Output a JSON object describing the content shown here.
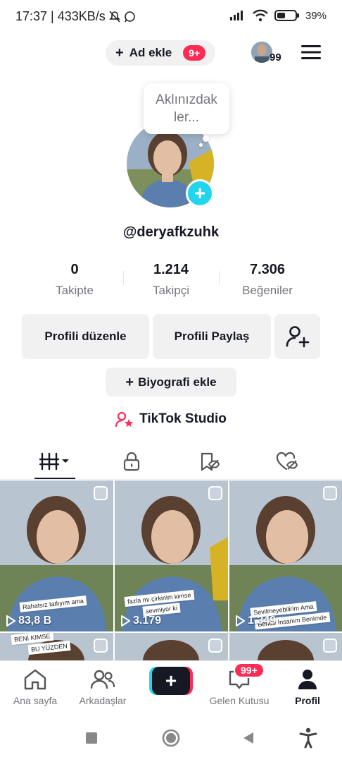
{
  "status_bar": {
    "time_info": "17:37 | 433KB/s",
    "battery": "39%",
    "icons": [
      "mute-bell-icon",
      "whatsapp-icon",
      "signal-icon",
      "wifi-icon",
      "battery-icon"
    ]
  },
  "top_bar": {
    "add_account_label": "Ad ekle",
    "notification_badge": "9+",
    "avatar_count": "99",
    "menu_icon": "hamburger-menu-icon"
  },
  "profile": {
    "bubble_text": "Aklınızdak ler...",
    "username": "@deryafkzuhk",
    "stats": [
      {
        "value": "0",
        "label": "Takipte"
      },
      {
        "value": "1.214",
        "label": "Takipçi"
      },
      {
        "value": "7.306",
        "label": "Beğeniler"
      }
    ],
    "edit_profile_label": "Profili düzenle",
    "share_profile_label": "Profili Paylaş",
    "add_bio_label": "Biyografi ekle",
    "studio_label": "TikTok Studio"
  },
  "tabs": [
    {
      "icon": "grid-videos-icon",
      "active": true
    },
    {
      "icon": "lock-icon",
      "active": false
    },
    {
      "icon": "saved-icon",
      "active": false
    },
    {
      "icon": "liked-icon",
      "active": false
    }
  ],
  "videos": [
    {
      "views": "83,8 B",
      "caption_1": "Rahatsız tatlıyım ama",
      "caption_2": "BENİ KIMSE",
      "caption_3": "BU YÜZDEN"
    },
    {
      "views": "3.179",
      "caption_1": "fazla mı çirkinim kimse",
      "caption_2": "sevmiyor ki"
    },
    {
      "views": "1.349",
      "caption_1": "Sevilmeyebilirim Ama",
      "caption_2": "Bende İnsanım Benimde"
    }
  ],
  "bottom_nav": {
    "home_label": "Ana sayfa",
    "friends_label": "Arkadaşlar",
    "inbox_label": "Gelen Kutusu",
    "inbox_badge": "99+",
    "profile_label": "Profil"
  },
  "colors": {
    "accent_red": "#fe2c55",
    "accent_cyan": "#20d5ec",
    "text_primary": "#161823",
    "text_secondary": "#75767d",
    "button_bg": "#f1f1f2"
  }
}
